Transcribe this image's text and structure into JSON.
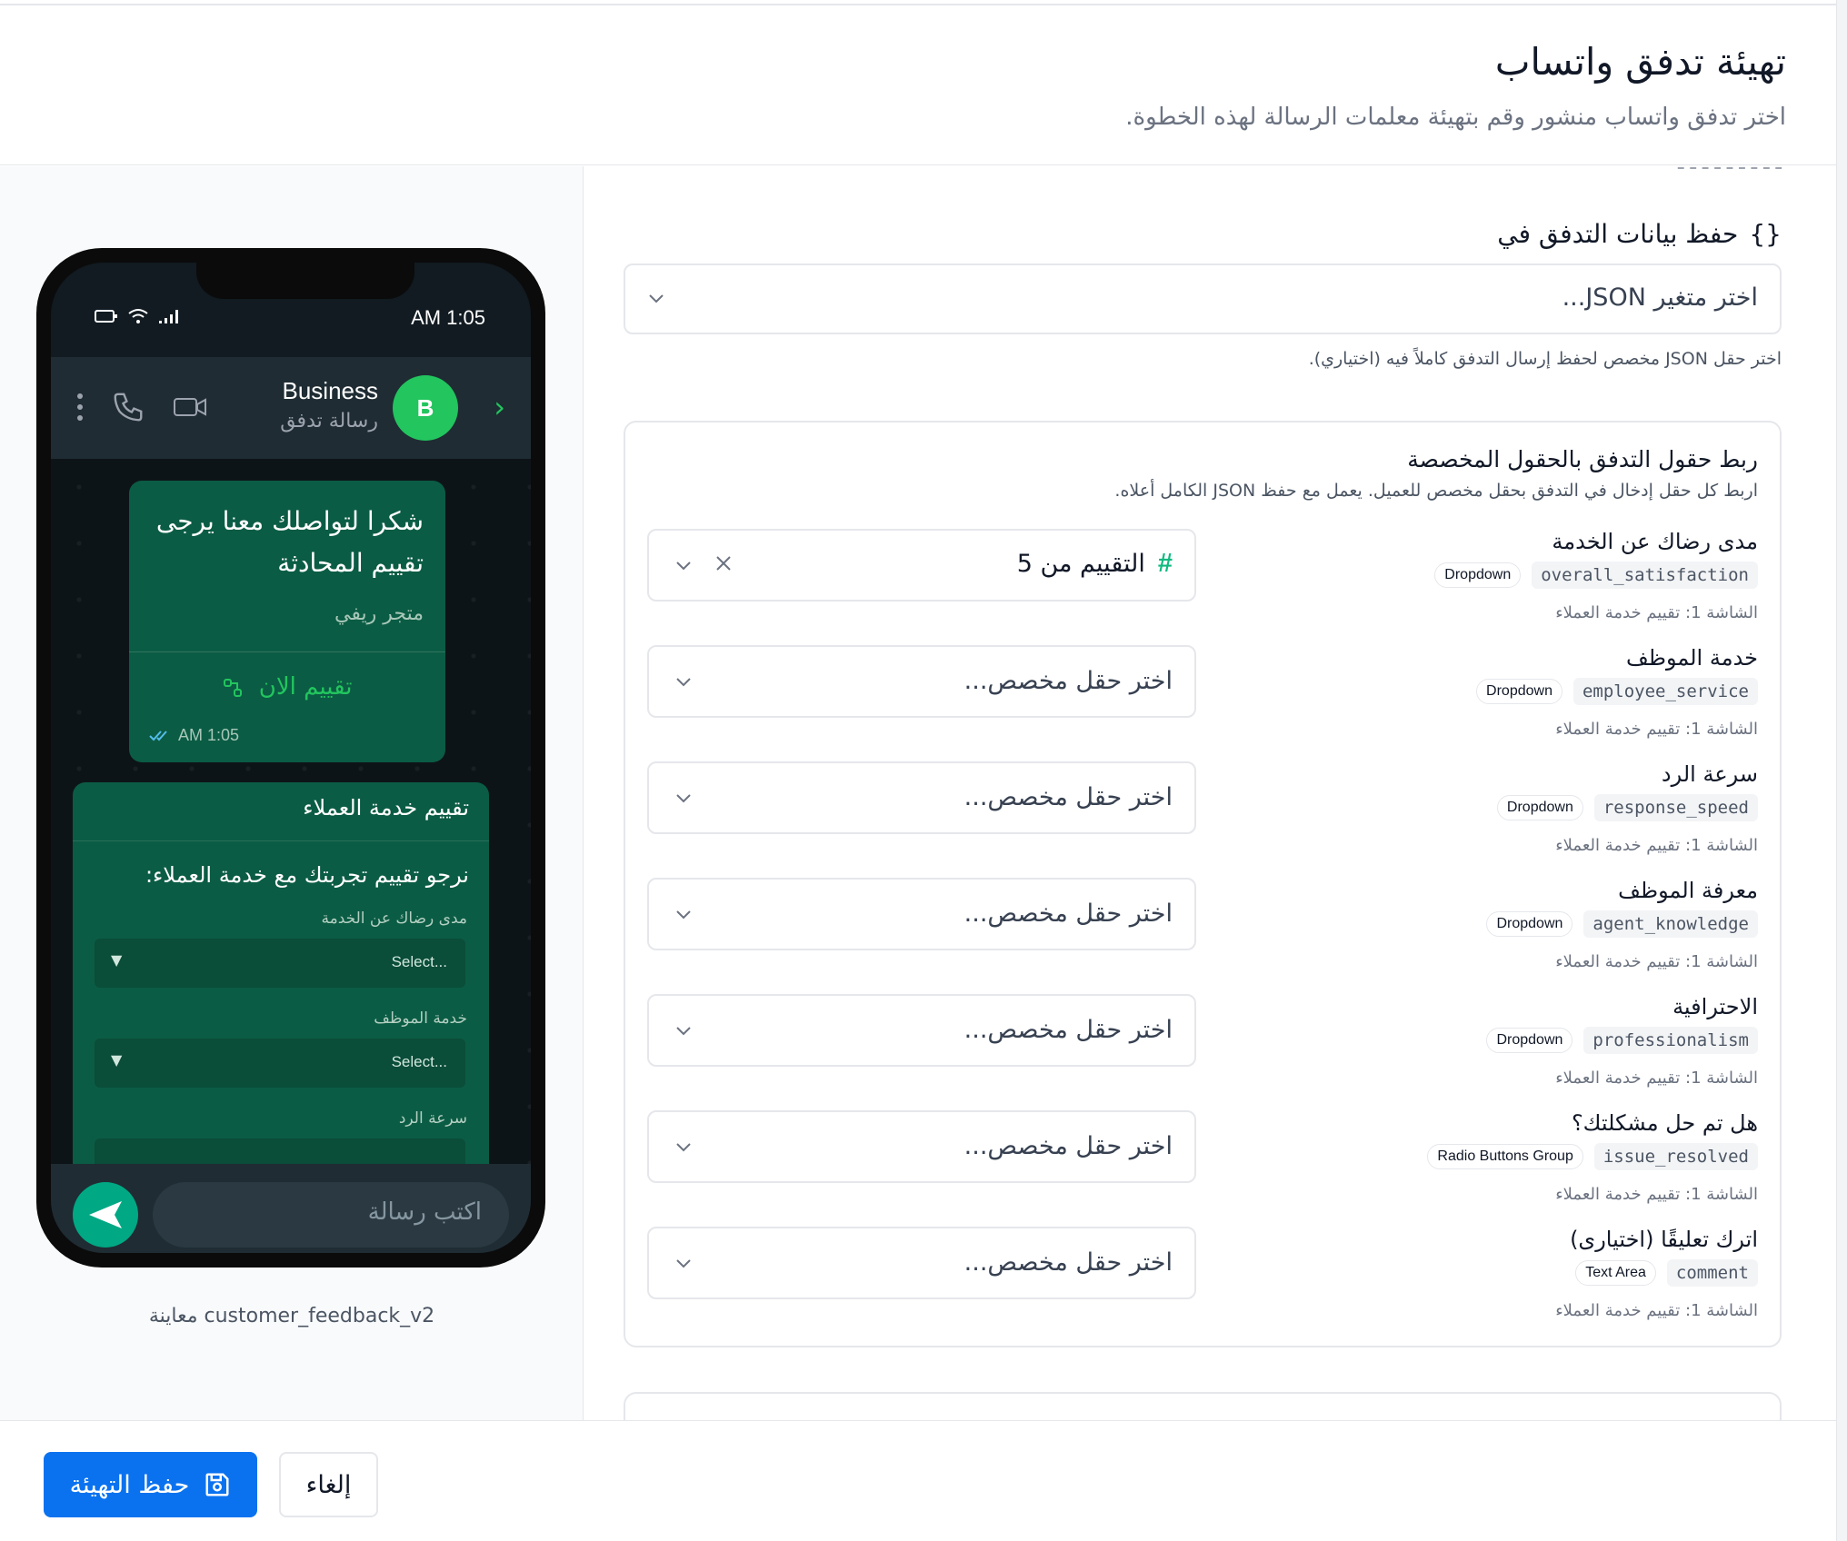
{
  "header": {
    "title": "تهيئة تدفق واتساب",
    "subtitle": "اختر تدفق واتساب منشور وقم بتهيئة معلمات الرسالة لهذه الخطوة."
  },
  "preview": {
    "status_time": "AM 1:05",
    "business_name": "Business",
    "business_subtitle": "رسالة تدفق",
    "avatar_letter": "B",
    "bubble": {
      "message": "شكرا لتواصلك معنا يرجى تقييم المحادثة",
      "sender": "متجر ريفي",
      "rate_label": "تقييم الان",
      "timestamp": "AM 1:05"
    },
    "form": {
      "title": "تقييم خدمة العملاء",
      "question": "نرجو تقييم تجربتك مع خدمة العملاء:",
      "fields": [
        {
          "label": "مدى رضاك عن الخدمة",
          "placeholder": "...Select"
        },
        {
          "label": "خدمة الموظف",
          "placeholder": "...Select"
        },
        {
          "label": "سرعة الرد",
          "placeholder": ""
        }
      ]
    },
    "compose_placeholder": "اكتب رسالة",
    "caption": "معاينة customer_feedback_v2"
  },
  "config": {
    "cut_text": "ـ ـ ـ ـ ـ ـ ـ ـ ـ",
    "save_section_icon": "{}",
    "save_section_title": "حفظ بيانات التدفق في",
    "json_placeholder": "اختر متغير JSON...",
    "json_help": "اختر حقل JSON مخصص لحفظ إرسال التدفق كاملاً فيه (اختياري).",
    "mapping_title": "ربط حقول التدفق بالحقول المخصصة",
    "mapping_subtitle": "اربط كل حقل إدخال في التدفق بحقل مخصص للعميل. يعمل مع حفظ JSON الكامل أعلاه.",
    "select_placeholder": "اختر حقل مخصص...",
    "fields": [
      {
        "name": "مدى رضاك عن الخدمة",
        "key": "overall_satisfaction",
        "type": "Dropdown",
        "screen": "الشاشة 1: تقييم خدمة العملاء",
        "selected": "التقييم من 5"
      },
      {
        "name": "خدمة الموظف",
        "key": "employee_service",
        "type": "Dropdown",
        "screen": "الشاشة 1: تقييم خدمة العملاء",
        "selected": ""
      },
      {
        "name": "سرعة الرد",
        "key": "response_speed",
        "type": "Dropdown",
        "screen": "الشاشة 1: تقييم خدمة العملاء",
        "selected": ""
      },
      {
        "name": "معرفة الموظف",
        "key": "agent_knowledge",
        "type": "Dropdown",
        "screen": "الشاشة 1: تقييم خدمة العملاء",
        "selected": ""
      },
      {
        "name": "الاحترافية",
        "key": "professionalism",
        "type": "Dropdown",
        "screen": "الشاشة 1: تقييم خدمة العملاء",
        "selected": ""
      },
      {
        "name": "هل تم حل مشكلتك؟",
        "key": "issue_resolved",
        "type": "Radio Buttons Group",
        "screen": "الشاشة 1: تقييم خدمة العملاء",
        "selected": ""
      },
      {
        "name": "اترك تعليقًا (اختيارى)",
        "key": "comment",
        "type": "Text Area",
        "screen": "الشاشة 1: تقييم خدمة العملاء",
        "selected": ""
      }
    ]
  },
  "footer": {
    "save_label": "حفظ التهيئة",
    "cancel_label": "إلغاء"
  },
  "colors": {
    "primary": "#0a72ef",
    "whatsapp_green": "#00a884",
    "bubble_green": "#0b5c44",
    "accent_green": "#22c55e"
  }
}
